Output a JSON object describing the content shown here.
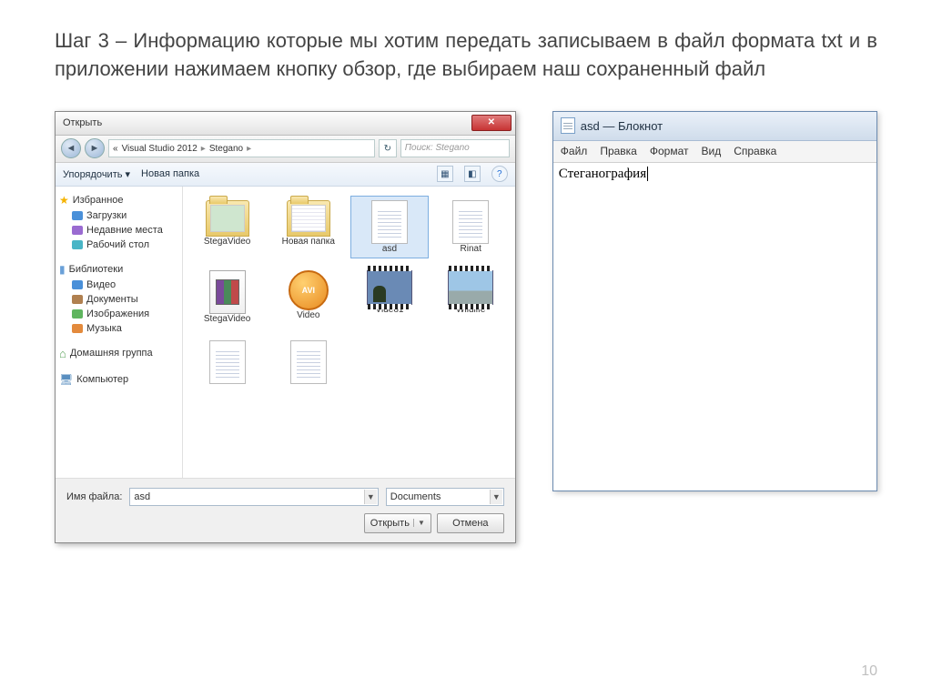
{
  "heading": "Шаг 3 – Информацию которые мы хотим передать записываем в файл формата txt и в приложении нажимаем кнопку обзор, где выбираем наш сохраненный файл",
  "page_number": "10",
  "dialog": {
    "title": "Открыть",
    "breadcrumb": [
      "Visual Studio 2012",
      "Stegano"
    ],
    "search_placeholder": "Поиск: Stegano",
    "toolbar": {
      "organize": "Упорядочить",
      "new_folder": "Новая папка"
    },
    "sidebar": {
      "favorites": {
        "title": "Избранное",
        "items": [
          "Загрузки",
          "Недавние места",
          "Рабочий стол"
        ]
      },
      "libraries": {
        "title": "Библиотеки",
        "items": [
          "Видео",
          "Документы",
          "Изображения",
          "Музыка"
        ]
      },
      "homegroup": "Домашняя группа",
      "computer": "Компьютер"
    },
    "files": [
      {
        "name": "StegaVideo",
        "type": "folder-green"
      },
      {
        "name": "Новая папка",
        "type": "folder"
      },
      {
        "name": "asd",
        "type": "txt",
        "selected": true
      },
      {
        "name": "Rinat",
        "type": "txt"
      },
      {
        "name": "StegaVideo",
        "type": "rar"
      },
      {
        "name": "Video",
        "type": "avi"
      },
      {
        "name": "Video1",
        "type": "video"
      },
      {
        "name": "Wildlife",
        "type": "video-wild"
      }
    ],
    "filename_label": "Имя файла:",
    "filename_value": "asd",
    "filter_value": "Documents",
    "open_btn": "Открыть",
    "cancel_btn": "Отмена"
  },
  "notepad": {
    "title": "asd — Блокнот",
    "menu": [
      "Файл",
      "Правка",
      "Формат",
      "Вид",
      "Справка"
    ],
    "content": "Стеганография"
  }
}
